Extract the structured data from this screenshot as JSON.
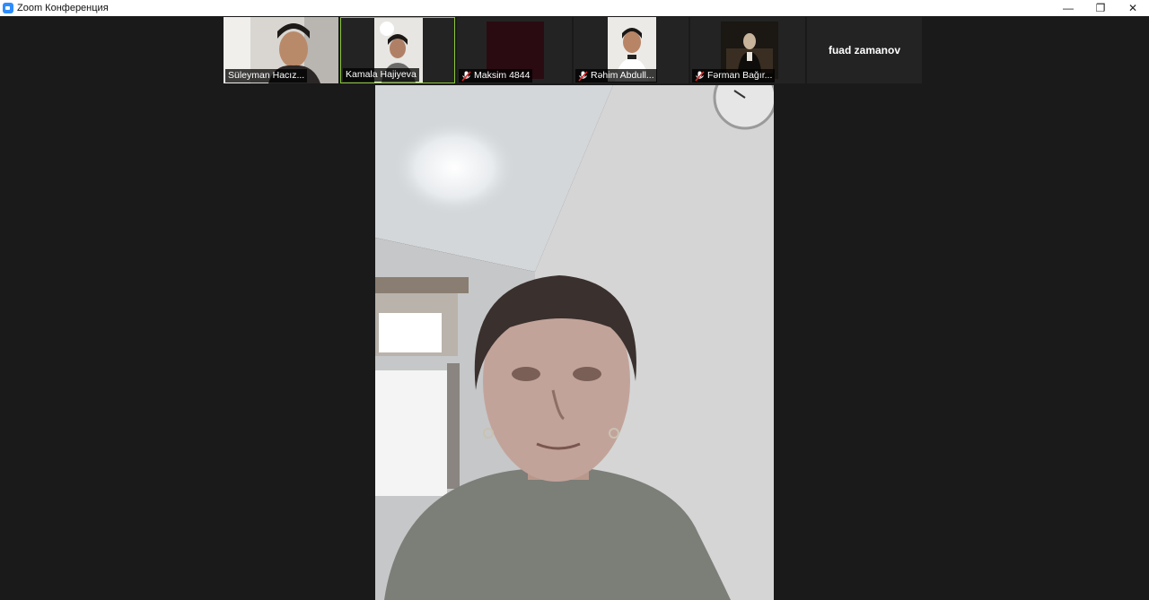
{
  "window": {
    "title": "Zoom Конференция",
    "controls": {
      "minimize": "—",
      "restore": "❐",
      "close": "✕"
    }
  },
  "participants": [
    {
      "name": "Süleyman Hacız...",
      "muted": false,
      "active": false
    },
    {
      "name": "Kamala Hajiyeva",
      "muted": false,
      "active": true
    },
    {
      "name": "Maksim 4844",
      "muted": true,
      "active": false
    },
    {
      "name": "Rəhim Abdull...",
      "muted": true,
      "active": false
    },
    {
      "name": "Fərman Bağır...",
      "muted": true,
      "active": false
    },
    {
      "name": "fuad zamanov",
      "muted": false,
      "active": false,
      "video_off": true
    }
  ],
  "colors": {
    "background": "#1a1a1a",
    "active_border": "#8cc63f",
    "mute_red": "#e02828"
  }
}
